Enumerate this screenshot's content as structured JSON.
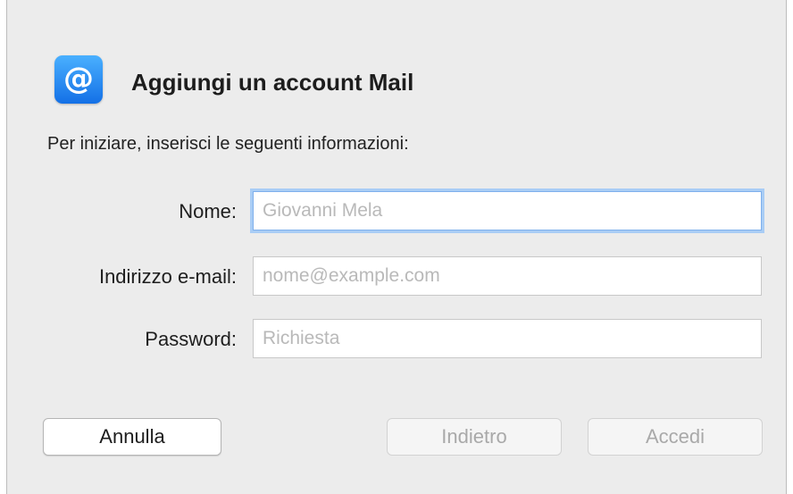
{
  "dialog": {
    "icon": "at-sign-mail-icon",
    "icon_glyph": "@",
    "title": "Aggiungi un account Mail",
    "subtitle": "Per iniziare, inserisci le seguenti informazioni:"
  },
  "form": {
    "name_label": "Nome:",
    "name_placeholder": "Giovanni Mela",
    "name_value": "",
    "email_label": "Indirizzo e-mail:",
    "email_placeholder": "nome@example.com",
    "email_value": "",
    "password_label": "Password:",
    "password_placeholder": "Richiesta",
    "password_value": ""
  },
  "buttons": {
    "cancel": "Annulla",
    "back": "Indietro",
    "sign_in": "Accedi"
  },
  "colors": {
    "accent": "#1470e6",
    "focus_ring": "#a9cdf5"
  }
}
